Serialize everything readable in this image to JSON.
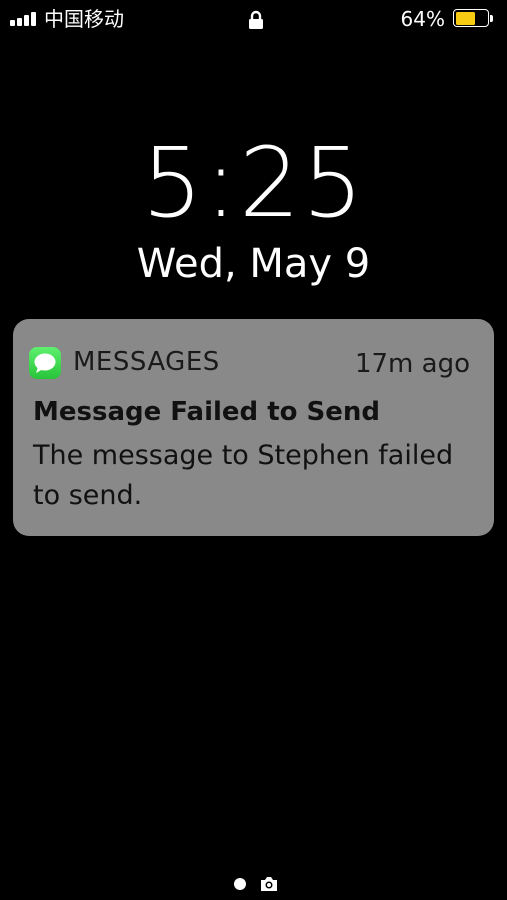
{
  "status_bar": {
    "carrier": "中国移动",
    "battery_percent_label": "64%",
    "battery_level": 0.64,
    "battery_color": "#f7cb12",
    "icons": [
      "signal-bars-icon",
      "lock-icon",
      "battery-icon"
    ]
  },
  "lock_screen": {
    "time": "5:25",
    "date": "Wed, May 9"
  },
  "notification": {
    "app_name": "MESSAGES",
    "app_icon": "messages-app-icon",
    "time_ago": "17m ago",
    "title": "Message Failed to Send",
    "body": "The message to Stephen failed to send."
  },
  "page_indicator": {
    "icons": [
      "page-dot",
      "camera-icon"
    ]
  }
}
